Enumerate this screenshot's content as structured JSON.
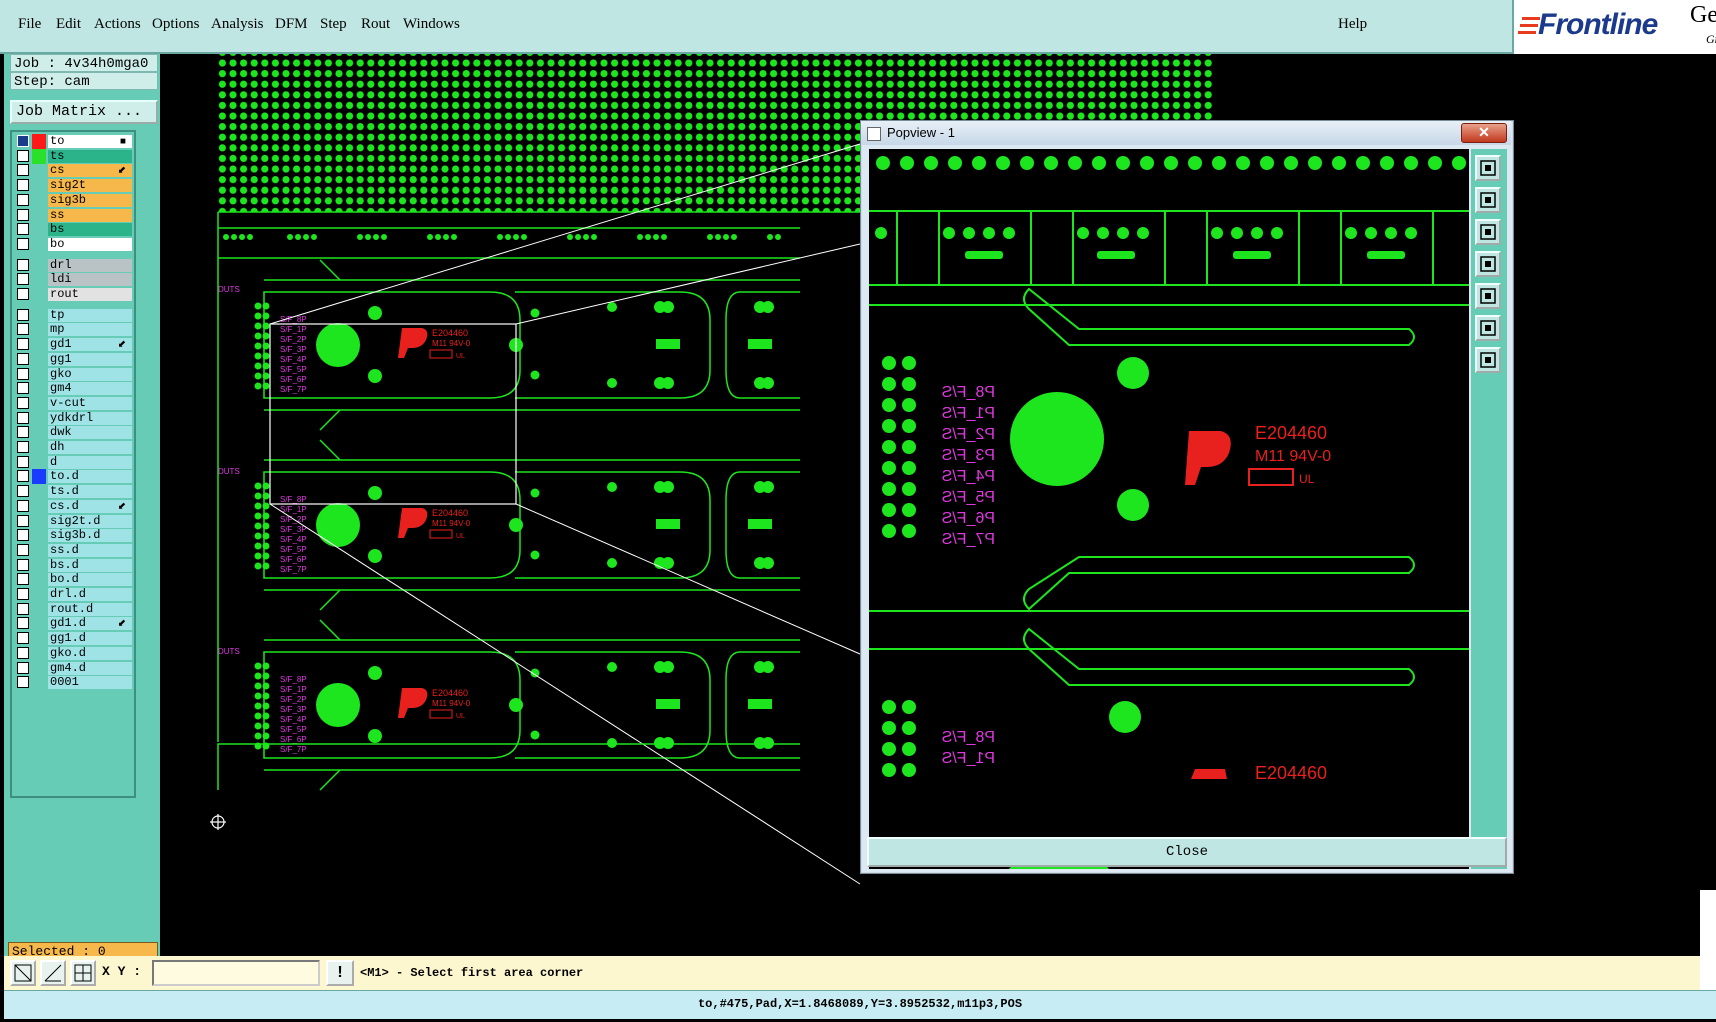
{
  "menu": {
    "items": [
      "File",
      "Edit",
      "Actions",
      "Options",
      "Analysis",
      "DFM",
      "Step",
      "Rout",
      "Windows"
    ],
    "help": "Help"
  },
  "brand": {
    "logo_text": "Frontline",
    "product_partial": "Gen",
    "subtitle_partial": "Gr"
  },
  "job": {
    "job_line": "Job : 4v34h0mga0",
    "step_line": "Step: cam",
    "matrix_button": "Job Matrix ..."
  },
  "layers": [
    {
      "name": "to",
      "color": "#ffffff",
      "swatch": "#ff1a1a",
      "selected": true,
      "marker": "■"
    },
    {
      "name": "ts",
      "color": "#2bb38a",
      "swatch": "#2be02b",
      "selected": false,
      "marker": ""
    },
    {
      "name": "cs",
      "color": "#f6b84a",
      "swatch": "",
      "selected": false,
      "marker": "⬋"
    },
    {
      "name": "sig2t",
      "color": "#f6b84a",
      "swatch": "",
      "selected": false,
      "marker": ""
    },
    {
      "name": "sig3b",
      "color": "#f6b84a",
      "swatch": "",
      "selected": false,
      "marker": ""
    },
    {
      "name": "ss",
      "color": "#f6b84a",
      "swatch": "",
      "selected": false,
      "marker": ""
    },
    {
      "name": "bs",
      "color": "#2bb38a",
      "swatch": "",
      "selected": false,
      "marker": ""
    },
    {
      "name": "bo",
      "color": "#ffffff",
      "swatch": "",
      "selected": false,
      "marker": ""
    },
    {
      "name": "drl",
      "color": "#b9c3c6",
      "swatch": "",
      "selected": false,
      "marker": ""
    },
    {
      "name": "ldi",
      "color": "#b9c3c6",
      "swatch": "",
      "selected": false,
      "marker": ""
    },
    {
      "name": "rout",
      "color": "#e2e2e2",
      "swatch": "",
      "selected": false,
      "marker": ""
    },
    {
      "name": "tp",
      "color": "#9fe3e6",
      "swatch": "",
      "selected": false,
      "marker": ""
    },
    {
      "name": "mp",
      "color": "#9fe3e6",
      "swatch": "",
      "selected": false,
      "marker": ""
    },
    {
      "name": "gd1",
      "color": "#9fe3e6",
      "swatch": "",
      "selected": false,
      "marker": "⬋"
    },
    {
      "name": "gg1",
      "color": "#9fe3e6",
      "swatch": "",
      "selected": false,
      "marker": ""
    },
    {
      "name": "gko",
      "color": "#9fe3e6",
      "swatch": "",
      "selected": false,
      "marker": ""
    },
    {
      "name": "gm4",
      "color": "#9fe3e6",
      "swatch": "",
      "selected": false,
      "marker": ""
    },
    {
      "name": "v-cut",
      "color": "#9fe3e6",
      "swatch": "",
      "selected": false,
      "marker": ""
    },
    {
      "name": "ydkdrl",
      "color": "#9fe3e6",
      "swatch": "",
      "selected": false,
      "marker": ""
    },
    {
      "name": "dwk",
      "color": "#9fe3e6",
      "swatch": "",
      "selected": false,
      "marker": ""
    },
    {
      "name": "dh",
      "color": "#9fe3e6",
      "swatch": "",
      "selected": false,
      "marker": ""
    },
    {
      "name": "d",
      "color": "#9fe3e6",
      "swatch": "",
      "selected": false,
      "marker": ""
    },
    {
      "name": "to.d",
      "color": "#9fe3e6",
      "swatch": "#1a3cff",
      "selected": false,
      "marker": ""
    },
    {
      "name": "ts.d",
      "color": "#9fe3e6",
      "swatch": "",
      "selected": false,
      "marker": ""
    },
    {
      "name": "cs.d",
      "color": "#9fe3e6",
      "swatch": "",
      "selected": false,
      "marker": "⬋"
    },
    {
      "name": "sig2t.d",
      "color": "#9fe3e6",
      "swatch": "",
      "selected": false,
      "marker": ""
    },
    {
      "name": "sig3b.d",
      "color": "#9fe3e6",
      "swatch": "",
      "selected": false,
      "marker": ""
    },
    {
      "name": "ss.d",
      "color": "#9fe3e6",
      "swatch": "",
      "selected": false,
      "marker": ""
    },
    {
      "name": "bs.d",
      "color": "#9fe3e6",
      "swatch": "",
      "selected": false,
      "marker": ""
    },
    {
      "name": "bo.d",
      "color": "#9fe3e6",
      "swatch": "",
      "selected": false,
      "marker": ""
    },
    {
      "name": "drl.d",
      "color": "#9fe3e6",
      "swatch": "",
      "selected": false,
      "marker": ""
    },
    {
      "name": "rout.d",
      "color": "#9fe3e6",
      "swatch": "",
      "selected": false,
      "marker": ""
    },
    {
      "name": "gd1.d",
      "color": "#9fe3e6",
      "swatch": "",
      "selected": false,
      "marker": "⬋"
    },
    {
      "name": "gg1.d",
      "color": "#9fe3e6",
      "swatch": "",
      "selected": false,
      "marker": ""
    },
    {
      "name": "gko.d",
      "color": "#9fe3e6",
      "swatch": "",
      "selected": false,
      "marker": ""
    },
    {
      "name": "gm4.d",
      "color": "#9fe3e6",
      "swatch": "",
      "selected": false,
      "marker": ""
    },
    {
      "name": "0001",
      "color": "#9fe3e6",
      "swatch": "",
      "selected": false,
      "marker": ""
    }
  ],
  "selected_text": "Selected : 0",
  "board": {
    "label": "DUTS",
    "ul_code": "E204460",
    "ul_grade": "M11 94V-0",
    "pins": [
      "P8_F/S",
      "P1_F/S",
      "P2_F/S",
      "P3_F/S",
      "P4_F/S",
      "P5_F/S",
      "P6_F/S",
      "P7_F/S"
    ]
  },
  "popview": {
    "title": "Popview - 1",
    "close_x": "✕",
    "close_label": "Close",
    "tools": [
      "fit-icon",
      "pan-up-icon",
      "pan-down-icon",
      "pan-left-icon",
      "pan-right-icon",
      "zoom-in-icon",
      "zoom-out-icon"
    ]
  },
  "cmd": {
    "xy_label": "X Y :",
    "xy_value": "",
    "xy_button": "!",
    "prompt": "<M1> - Select first area corner"
  },
  "status": "to,#475,Pad,X=1.8468089,Y=3.8952532,m11p3,POS",
  "colors": {
    "copper": "#1ee61e",
    "silk": "#e8401e",
    "pin_label": "#e038e0",
    "panel": "#66ccb6",
    "menu": "#bfe6e3"
  }
}
